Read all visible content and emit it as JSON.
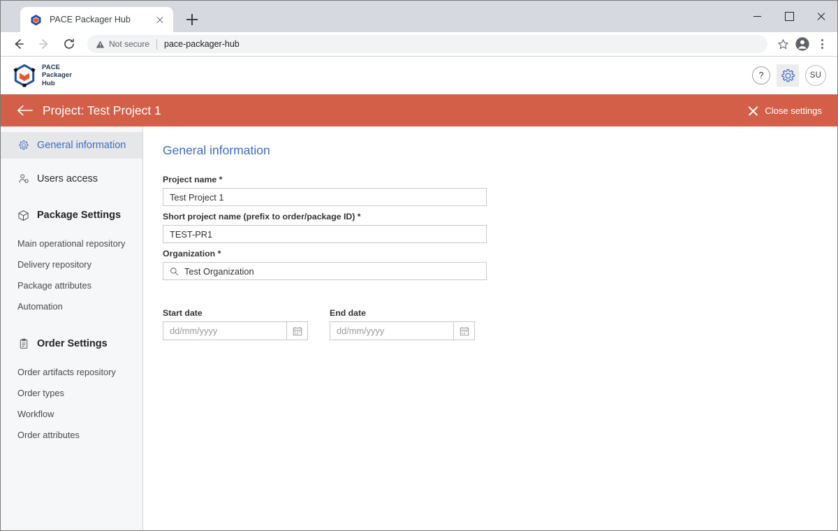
{
  "browser": {
    "tab": {
      "title": "PACE Packager Hub",
      "favicon": "pace-cube-favicon"
    },
    "newtab_tooltip": "New tab",
    "security_label": "Not secure",
    "url": "pace-packager-hub"
  },
  "app_header": {
    "brand": {
      "line1": "PACE",
      "line2": "Packager",
      "line3": "Hub"
    },
    "help_label": "?",
    "avatar_initials": "SU"
  },
  "page_bar": {
    "title": "Project: Test Project 1",
    "close_label": "Close settings",
    "accent_color": "#d45f48"
  },
  "sidebar": {
    "items": [
      {
        "label": "General information",
        "icon": "gear-icon",
        "type": "main",
        "active": true
      },
      {
        "label": "Users access",
        "icon": "users-icon",
        "type": "main",
        "active": false
      },
      {
        "label": "Package Settings",
        "icon": "package-icon",
        "type": "section",
        "active": false
      },
      {
        "label": "Main operational repository",
        "type": "sub",
        "active": false
      },
      {
        "label": "Delivery repository",
        "type": "sub",
        "active": false
      },
      {
        "label": "Package attributes",
        "type": "sub",
        "active": false
      },
      {
        "label": "Automation",
        "type": "sub",
        "active": false
      },
      {
        "label": "Order Settings",
        "icon": "clipboard-icon",
        "type": "section",
        "active": false
      },
      {
        "label": "Order artifacts repository",
        "type": "sub",
        "active": false
      },
      {
        "label": "Order types",
        "type": "sub",
        "active": false
      },
      {
        "label": "Workflow",
        "type": "sub",
        "active": false
      },
      {
        "label": "Order attributes",
        "type": "sub",
        "active": false
      }
    ]
  },
  "main": {
    "title": "General information",
    "accent_color": "#3c6cc4",
    "fields": {
      "project_name": {
        "label": "Project name *",
        "value": "Test Project 1"
      },
      "short_name": {
        "label": "Short project name (prefix to order/package ID) *",
        "value": "TEST-PR1"
      },
      "organization": {
        "label": "Organization *",
        "value": "Test Organization",
        "icon": "search-icon"
      },
      "start_date": {
        "label": "Start date",
        "value": "",
        "placeholder": "dd/mm/yyyy",
        "icon": "calendar-icon"
      },
      "end_date": {
        "label": "End date",
        "value": "",
        "placeholder": "dd/mm/yyyy",
        "icon": "calendar-icon"
      }
    }
  }
}
